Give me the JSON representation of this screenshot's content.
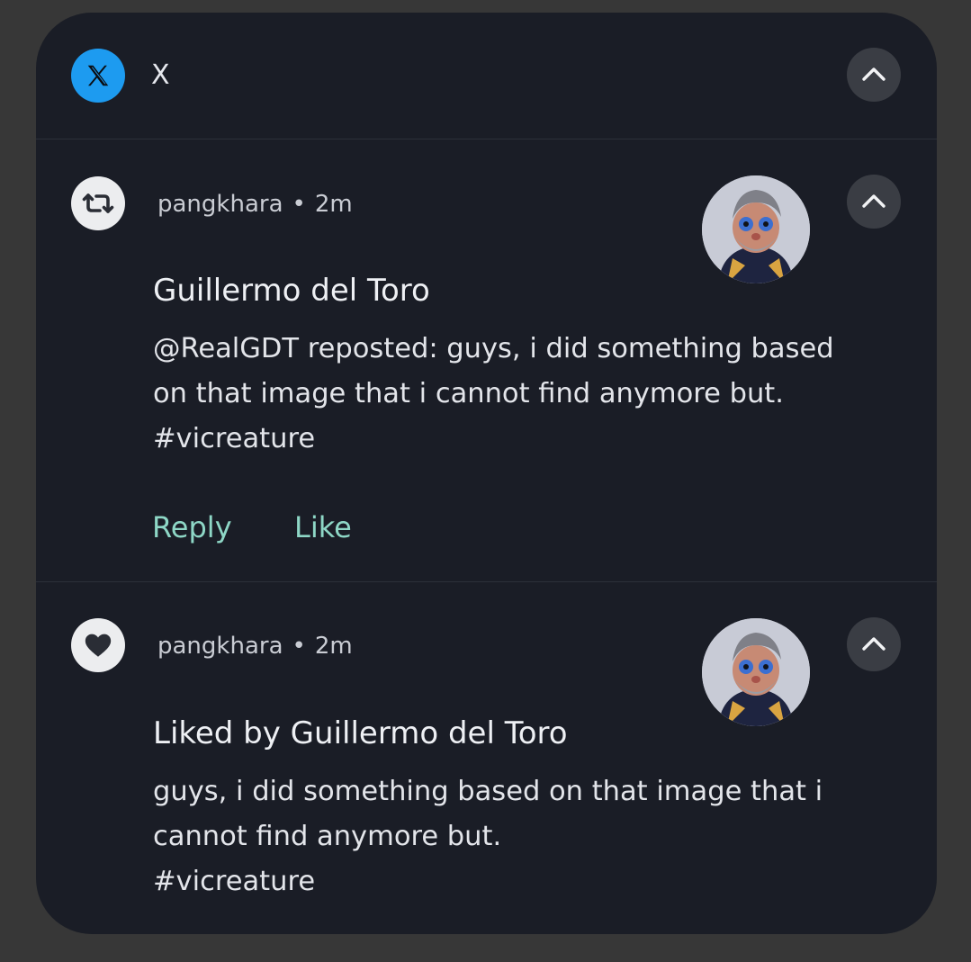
{
  "app": {
    "name": "X",
    "icon": "x-logo-icon",
    "brand_color": "#1d9bf0"
  },
  "notifications": [
    {
      "type_icon": "repost-icon",
      "author": "pangkhara",
      "separator": "•",
      "time": "2m",
      "title": "Guillermo del Toro",
      "body_lines": [
        "@RealGDT reposted: guys, i did something based",
        "on that image that i cannot find anymore but.",
        "#vicreature"
      ],
      "actions": [
        "Reply",
        "Like"
      ]
    },
    {
      "type_icon": "heart-icon",
      "author": "pangkhara",
      "separator": "•",
      "time": "2m",
      "title": "Liked by Guillermo del Toro",
      "body_lines": [
        "guys, i did something based on that image that i",
        "cannot find anymore but.",
        "#vicreature"
      ]
    }
  ],
  "colors": {
    "card_background": "#1a1d26",
    "action_text": "#8ed7c6",
    "button_background": "#3a3d44"
  }
}
